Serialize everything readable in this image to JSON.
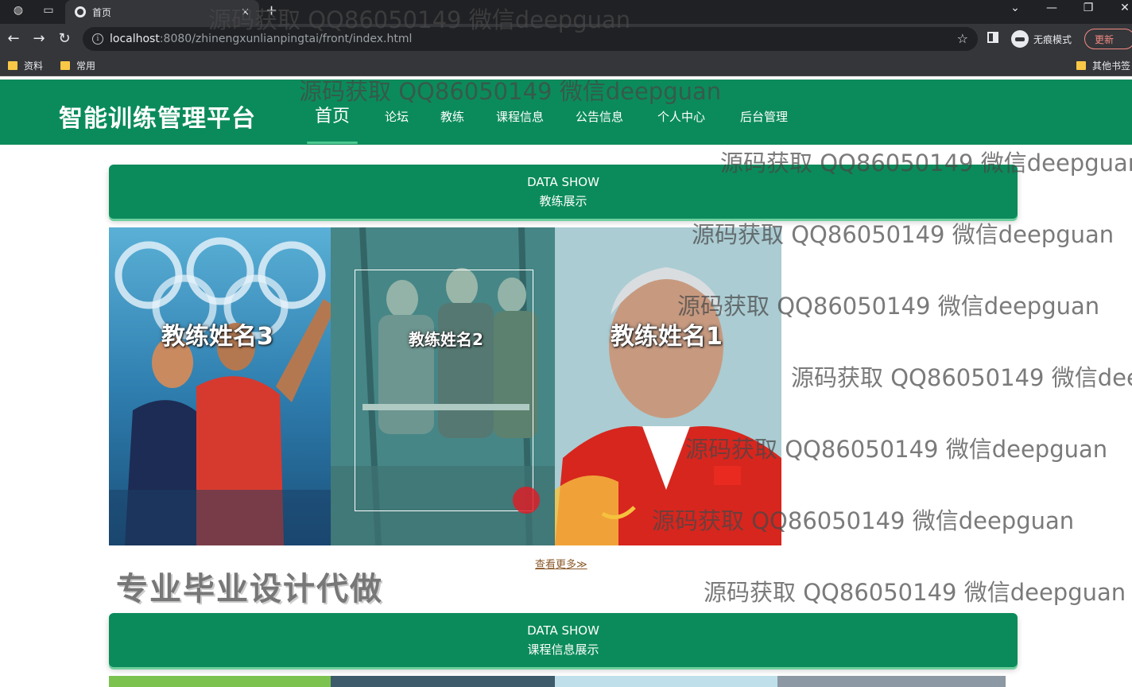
{
  "browser": {
    "tab_title": "首页",
    "tab_close": "×",
    "new_tab": "+",
    "url_host": "localhost",
    "url_path": ":8080/zhinengxunlianpingtai/front/index.html",
    "profile_label": "无痕模式",
    "update_label": "更新",
    "bookmarks": [
      "资料",
      "常用",
      "其他书签"
    ],
    "icons": {
      "back": "←",
      "forward": "→",
      "reload": "↻",
      "info": "i",
      "star": "☆",
      "minimize": "—",
      "restore": "❐",
      "close": "✕",
      "tab_search": "⌄"
    }
  },
  "site": {
    "title": "智能训练管理平台",
    "nav": [
      "首页",
      "论坛",
      "教练",
      "课程信息",
      "公告信息",
      "个人中心",
      "后台管理"
    ],
    "active_nav": "首页"
  },
  "coach_section": {
    "en": "DATA SHOW",
    "cn": "教练展示",
    "coaches": [
      "教练姓名3",
      "教练姓名2",
      "教练姓名1"
    ],
    "more": "查看更多≫"
  },
  "promo_text": "专业毕业设计代做",
  "course_section": {
    "en": "DATA SHOW",
    "cn": "课程信息展示"
  },
  "watermark": "源码获取 QQ86050149 微信deepguan",
  "colors": {
    "primary": "#0b8b5b",
    "accent": "#4ec892",
    "browser_dark": "#202124",
    "browser_mid": "#35363a"
  }
}
